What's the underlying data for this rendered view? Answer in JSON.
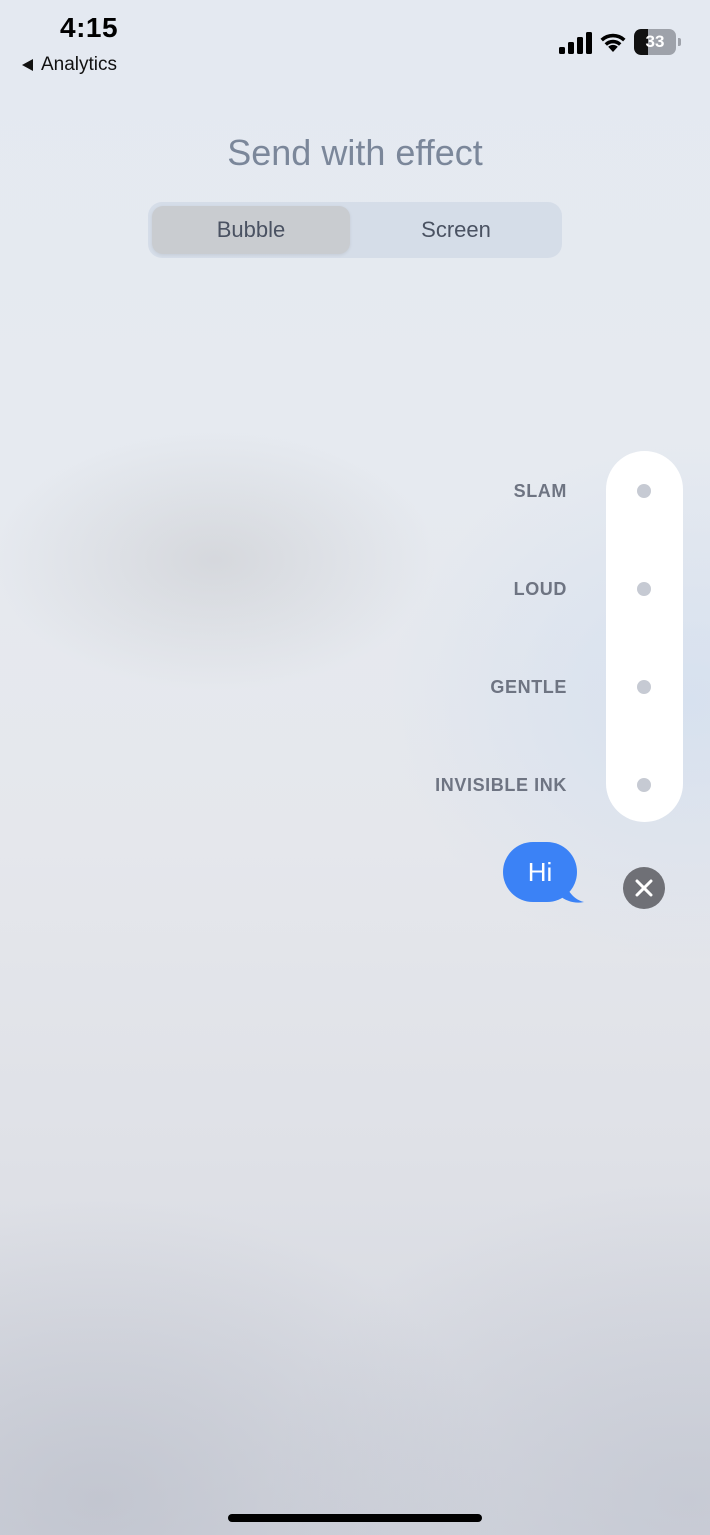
{
  "status_bar": {
    "time": "4:15",
    "back_label": "Analytics",
    "battery_level": "33",
    "battery_fraction": 0.33,
    "signal_icon": "cellular-signal-icon",
    "wifi_icon": "wifi-icon",
    "battery_icon": "battery-icon"
  },
  "header": {
    "title": "Send with effect"
  },
  "segmented": {
    "options": [
      "Bubble",
      "Screen"
    ],
    "selected": "Bubble"
  },
  "effects": [
    {
      "label": "SLAM"
    },
    {
      "label": "LOUD"
    },
    {
      "label": "GENTLE"
    },
    {
      "label": "INVISIBLE INK"
    }
  ],
  "message": {
    "text": "Hi",
    "bubble_color": "#3b82f6"
  },
  "cancel": {
    "icon": "close-icon"
  },
  "colors": {
    "title": "#7b879a",
    "effect_label": "#6e7482",
    "effect_dot": "#c6cad3",
    "cancel_button": "#6f7076"
  }
}
